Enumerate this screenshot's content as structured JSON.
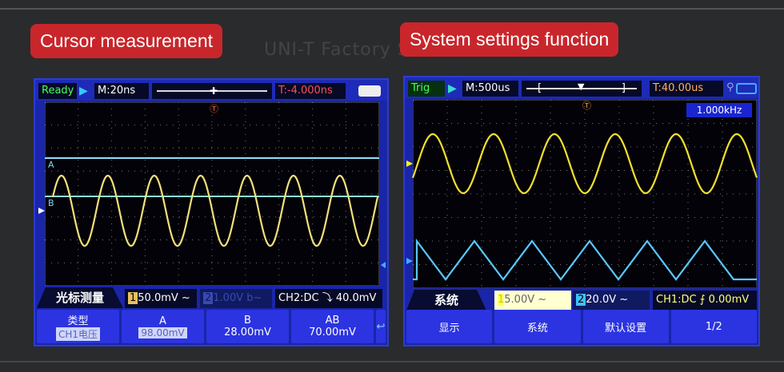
{
  "watermark": "UNI-T Factory Store",
  "left": {
    "title": "Cursor measurement",
    "status": "Ready",
    "timebase": "M:20ns",
    "trigger_time": "T:-4.000ns",
    "cursor_a": "A",
    "cursor_b": "B",
    "menu_tab": "光标测量",
    "ch1": "1",
    "ch1_scale": "50.0mV ~",
    "ch2": "2",
    "ch2_scale": "1.00V  b~",
    "trigger_info": "CH2:DC ⤵ 40.0mV",
    "menu": [
      {
        "label": "类型",
        "value": "CH1电压"
      },
      {
        "label": "A",
        "value": "98.00mV"
      },
      {
        "label": "B",
        "value": "28.00mV"
      },
      {
        "label": "AB",
        "value": "70.00mV"
      }
    ],
    "return_icon": "↩"
  },
  "right": {
    "title": "System settings function",
    "status": "Trig",
    "timebase": "M:500us",
    "trigger_time": "T:40.00us",
    "frequency": "1.000kHz",
    "menu_tab": "系统",
    "ch1": "1",
    "ch1_scale": "5.00V      ~",
    "ch2": "2",
    "ch2_scale": "20.0V      ~",
    "trigger_info": "CH1:DC ⨍ 0.00mV",
    "menu": [
      "显示",
      "系统",
      "默认设置",
      "1/2"
    ]
  }
}
